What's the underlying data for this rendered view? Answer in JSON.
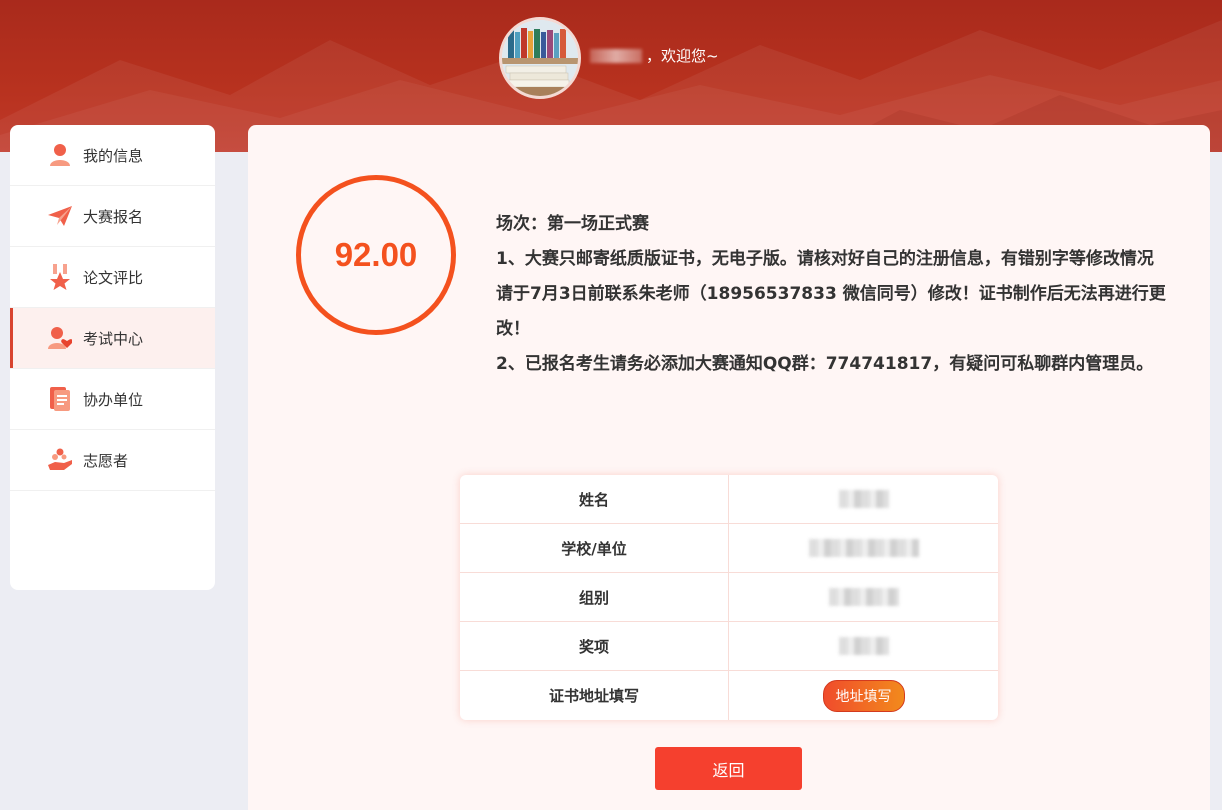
{
  "header": {
    "welcome_text": "，欢迎您~"
  },
  "sidebar": {
    "items": [
      {
        "label": "我的信息",
        "icon": "user-icon"
      },
      {
        "label": "大赛报名",
        "icon": "paper-plane-icon"
      },
      {
        "label": "论文评比",
        "icon": "medal-icon"
      },
      {
        "label": "考试中心",
        "icon": "user-heart-icon",
        "active": true
      },
      {
        "label": "协办单位",
        "icon": "document-icon"
      },
      {
        "label": "志愿者",
        "icon": "hand-heart-icon"
      }
    ]
  },
  "score": "92.00",
  "notice": {
    "session": "场次：第一场正式赛",
    "line1": "1、大赛只邮寄纸质版证书，无电子版。请核对好自己的注册信息，有错别字等修改情况请于7月3日前联系朱老师（18956537833 微信同号）修改！证书制作后无法再进行更改！",
    "line2": "2、已报名考生请务必添加大赛通知QQ群：774741817，有疑问可私聊群内管理员。"
  },
  "info_table": {
    "rows": [
      {
        "key": "姓名"
      },
      {
        "key": "学校/单位"
      },
      {
        "key": "组别"
      },
      {
        "key": "奖项"
      },
      {
        "key": "证书地址填写",
        "button": "地址填写"
      }
    ]
  },
  "back_button": "返回",
  "colors": {
    "accent": "#f4511e",
    "banner": "#b8321f",
    "button": "#f5402e"
  }
}
